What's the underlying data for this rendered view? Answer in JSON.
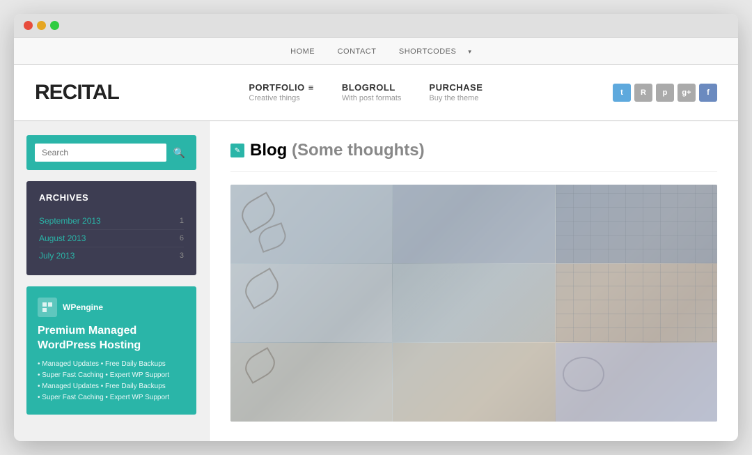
{
  "browser": {
    "buttons": {
      "close": "close",
      "minimize": "minimize",
      "maximize": "maximize"
    }
  },
  "topnav": {
    "items": [
      {
        "label": "HOME",
        "href": "#"
      },
      {
        "label": "CONTACT",
        "href": "#"
      },
      {
        "label": "SHORTCODES",
        "href": "#",
        "has_dropdown": true
      }
    ]
  },
  "header": {
    "logo": "RECITAL",
    "nav": [
      {
        "id": "portfolio",
        "label": "PORTFOLIO",
        "subtitle": "Creative things",
        "has_menu": true
      },
      {
        "id": "blogroll",
        "label": "BLOGROLL",
        "subtitle": "With post formats"
      },
      {
        "id": "purchase",
        "label": "PURCHASE",
        "subtitle": "Buy the theme"
      }
    ],
    "social_icons": [
      {
        "name": "twitter",
        "symbol": "t"
      },
      {
        "name": "rss",
        "symbol": "R"
      },
      {
        "name": "pinterest",
        "symbol": "p"
      },
      {
        "name": "google-plus",
        "symbol": "g+"
      },
      {
        "name": "facebook",
        "symbol": "f"
      }
    ]
  },
  "sidebar": {
    "search": {
      "placeholder": "Search",
      "button_label": "🔍"
    },
    "archives": {
      "title": "Archives",
      "items": [
        {
          "label": "September 2013",
          "count": "1"
        },
        {
          "label": "August 2013",
          "count": "6"
        },
        {
          "label": "July 2013",
          "count": "3"
        }
      ]
    },
    "ad": {
      "logo_text": "WPengine",
      "headline": "Premium Managed WordPress Hosting",
      "features": [
        "• Managed Updates  • Free Daily Backups",
        "• Super Fast Caching  • Expert WP Support",
        "• Managed Updates  • Free Daily Backups",
        "• Super Fast Caching  • Expert WP Support"
      ]
    }
  },
  "main": {
    "blog_label": "Blog",
    "blog_subtitle": "(Some thoughts)",
    "blog_icon": "✎"
  },
  "colors": {
    "teal": "#2ab5a8",
    "dark_sidebar": "#3d3d52",
    "link_color": "#2ab5a8"
  }
}
